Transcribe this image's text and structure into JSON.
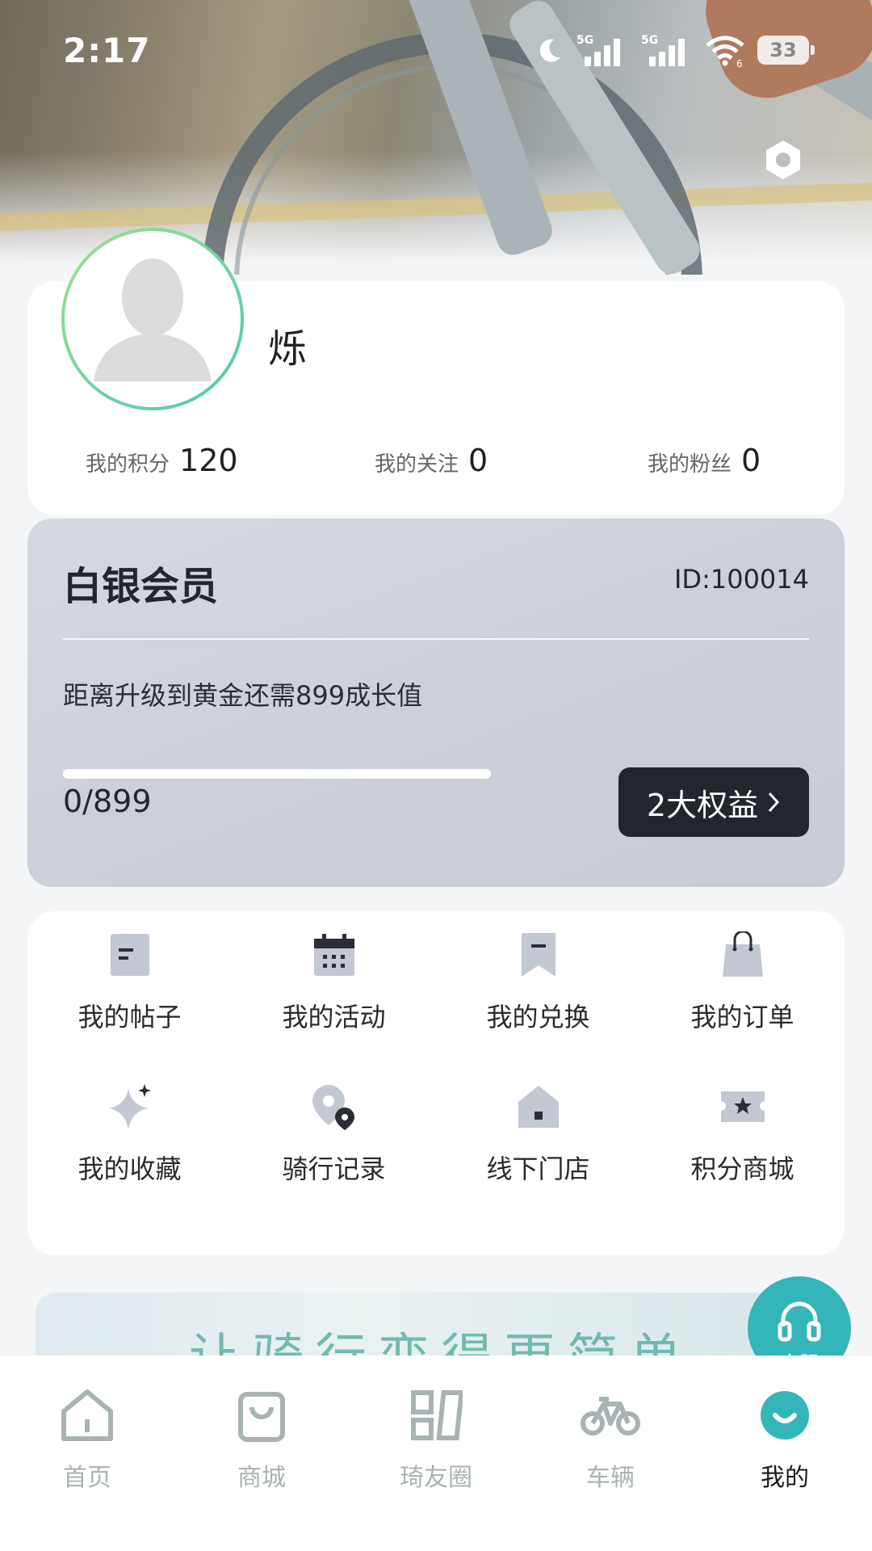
{
  "status_bar": {
    "time": "2:17",
    "network_1": "5G",
    "network_2": "5G",
    "wifi_sub": "6",
    "battery": "33"
  },
  "profile": {
    "username": "烁",
    "stats": [
      {
        "label": "我的积分",
        "value": "120"
      },
      {
        "label": "我的关注",
        "value": "0"
      },
      {
        "label": "我的粉丝",
        "value": "0"
      }
    ]
  },
  "membership": {
    "level": "白银会员",
    "id_text": "ID:100014",
    "upgrade_text": "距离升级到黄金还需899成长值",
    "progress_text": "0/899",
    "progress_fraction": 0,
    "benefits_label": "2大权益"
  },
  "grid": {
    "items": [
      {
        "label": "我的帖子",
        "icon": "post-icon"
      },
      {
        "label": "我的活动",
        "icon": "calendar-icon"
      },
      {
        "label": "我的兑换",
        "icon": "bookmark-icon"
      },
      {
        "label": "我的订单",
        "icon": "shopping-bag-icon"
      },
      {
        "label": "我的收藏",
        "icon": "sparkle-icon"
      },
      {
        "label": "骑行记录",
        "icon": "location-pin-icon"
      },
      {
        "label": "线下门店",
        "icon": "store-icon"
      },
      {
        "label": "积分商城",
        "icon": "ticket-star-icon"
      }
    ]
  },
  "banner": {
    "text": "让骑行变得更简单"
  },
  "service": {
    "label": "客服"
  },
  "nav": {
    "items": [
      {
        "label": "首页",
        "icon": "home-icon"
      },
      {
        "label": "商城",
        "icon": "shop-icon"
      },
      {
        "label": "琦友圈",
        "icon": "community-icon"
      },
      {
        "label": "车辆",
        "icon": "bicycle-icon"
      },
      {
        "label": "我的",
        "icon": "profile-smile-icon"
      }
    ],
    "active": "我的"
  },
  "colors": {
    "accent": "#33b5b9",
    "dark": "#23262d",
    "nav_inactive": "#aab3b3",
    "card_bg": "#ffffff"
  }
}
